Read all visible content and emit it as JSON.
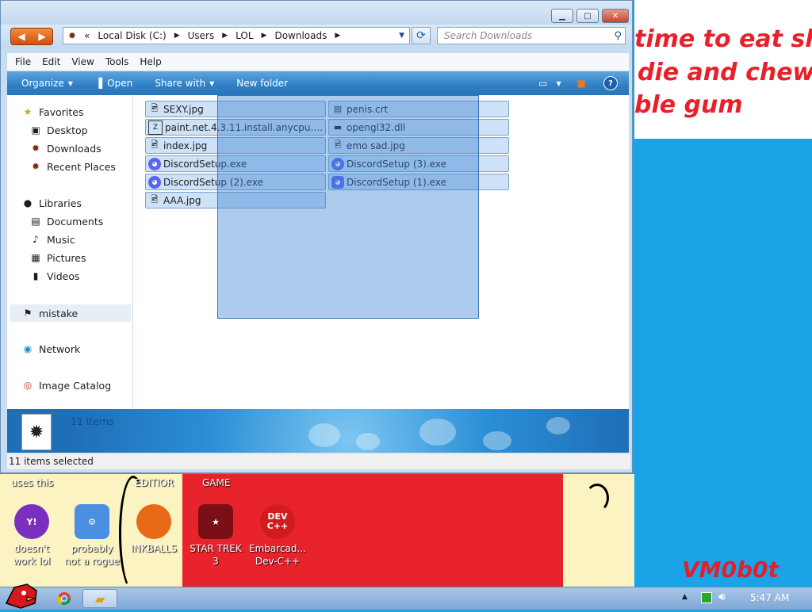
{
  "wallpaper": {
    "lines": [
      "time to eat shit",
      "die and chew",
      "ble gum"
    ],
    "watermark": "VM0b0t",
    "top_labels": [
      "uses this",
      "EDITIOR",
      "GAME"
    ]
  },
  "desktop_icons": [
    {
      "label1": "doesn't",
      "label2": "work lol",
      "icon": "yahoo-messenger-icon",
      "color": "#7b2fbf"
    },
    {
      "label1": "probably",
      "label2": "not a rogue",
      "icon": "system-settings-icon",
      "color": "#2f6fd0"
    },
    {
      "label1": "INKBALLS",
      "label2": "",
      "icon": "inkball-icon",
      "color": "#e86a16"
    },
    {
      "label1": "STAR TREK",
      "label2": "3",
      "icon": "star-wars-game-icon",
      "color": "#b3141a"
    },
    {
      "label1": "Embarcad...",
      "label2": "Dev-C++",
      "icon": "devcpp-icon",
      "color": "#d01c1c"
    }
  ],
  "window": {
    "address": {
      "prefix": "«",
      "crumbs": [
        "Local Disk (C:)",
        "Users",
        "LOL",
        "Downloads"
      ]
    },
    "search_placeholder": "Search Downloads",
    "menu": [
      "File",
      "Edit",
      "View",
      "Tools",
      "Help"
    ],
    "commands": {
      "organize": "Organize",
      "open": "Open",
      "share_with": "Share with",
      "new_folder": "New folder"
    },
    "nav": {
      "favorites": "Favorites",
      "desktop": "Desktop",
      "downloads": "Downloads",
      "recent": "Recent Places",
      "libraries": "Libraries",
      "documents": "Documents",
      "music": "Music",
      "pictures": "Pictures",
      "videos": "Videos",
      "mistake": "mistake",
      "network": "Network",
      "image_catalog": "Image Catalog"
    },
    "files": [
      {
        "name": "SEXY.jpg",
        "icon": "image-file-icon"
      },
      {
        "name": "penis.crt",
        "icon": "certificate-icon"
      },
      {
        "name": "paint.net.4.3.11.install.anycpu.we...",
        "icon": "paint-net-icon"
      },
      {
        "name": "opengl32.dll",
        "icon": "dll-file-icon"
      },
      {
        "name": "index.jpg",
        "icon": "image-file-icon"
      },
      {
        "name": "emo sad.jpg",
        "icon": "image-file-icon"
      },
      {
        "name": "DiscordSetup.exe",
        "icon": "discord-icon"
      },
      {
        "name": "DiscordSetup (3).exe",
        "icon": "discord-icon"
      },
      {
        "name": "DiscordSetup (2).exe",
        "icon": "discord-icon"
      },
      {
        "name": "DiscordSetup (1).exe",
        "icon": "discord-icon"
      },
      {
        "name": "AAA.jpg",
        "icon": "image-file-icon"
      }
    ],
    "details_count": "11 items",
    "status": "11 items selected"
  },
  "taskbar": {
    "clock": "5:47 AM"
  }
}
